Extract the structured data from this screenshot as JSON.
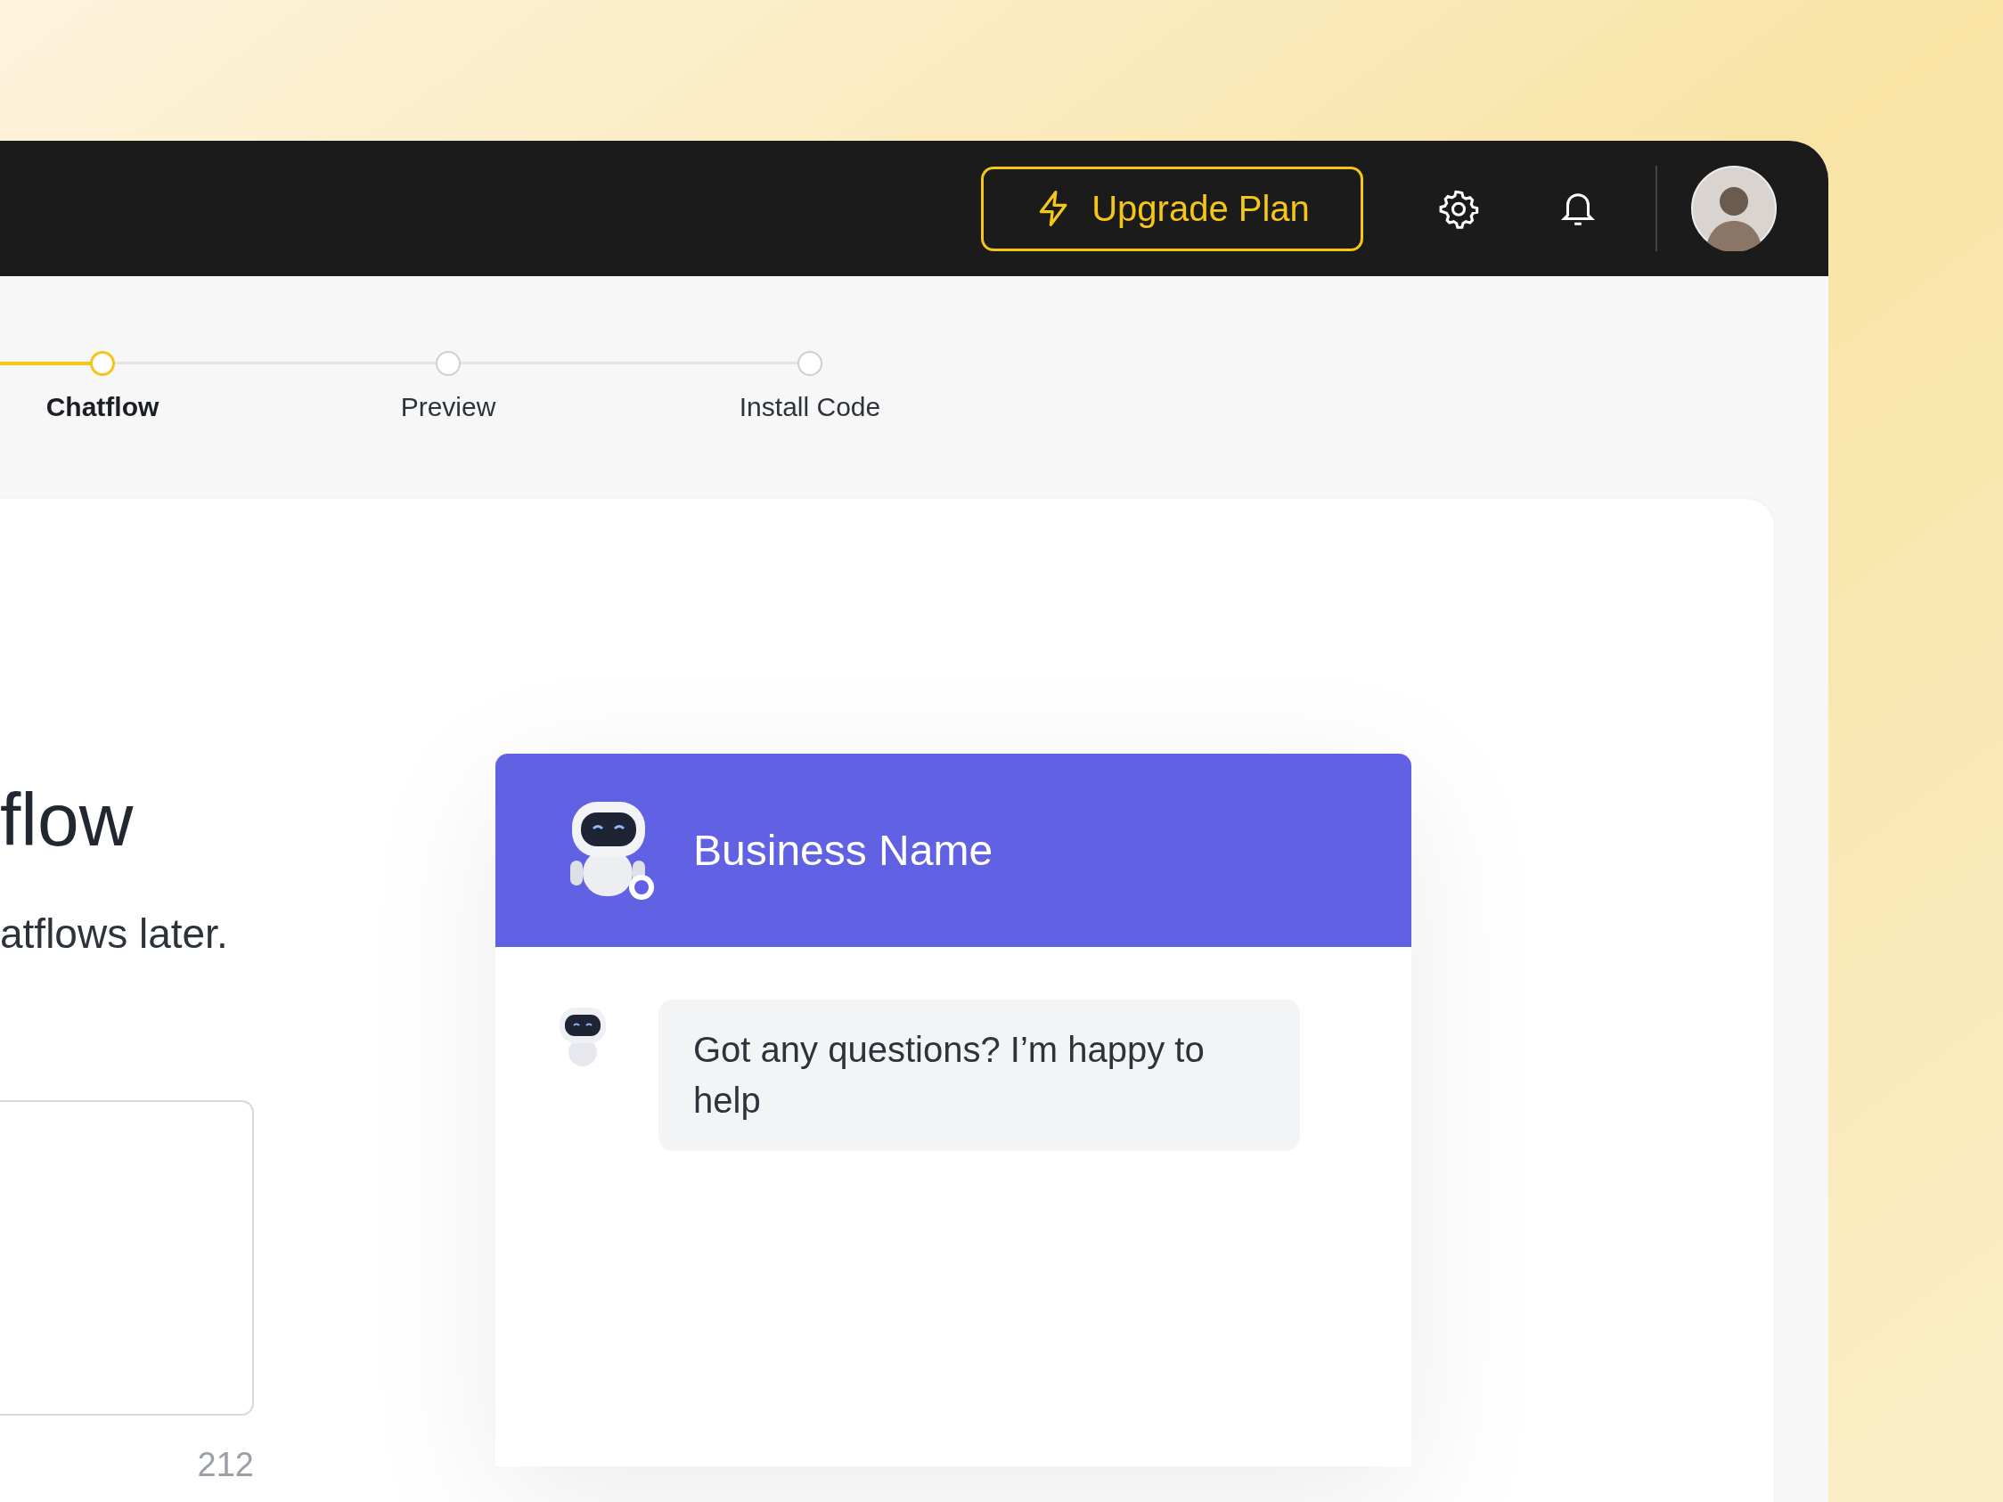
{
  "header": {
    "upgrade_button": "Upgrade Plan"
  },
  "steps": [
    {
      "label": "Chatflow",
      "selected": true
    },
    {
      "label": "Preview",
      "selected": false
    },
    {
      "label": "Install Code",
      "selected": false
    }
  ],
  "form": {
    "heading": "flow",
    "subtitle": "atflows later.",
    "counter": "212"
  },
  "chat_preview": {
    "business_name": "Business Name",
    "message": "Got any questions? I’m happy to help"
  }
}
